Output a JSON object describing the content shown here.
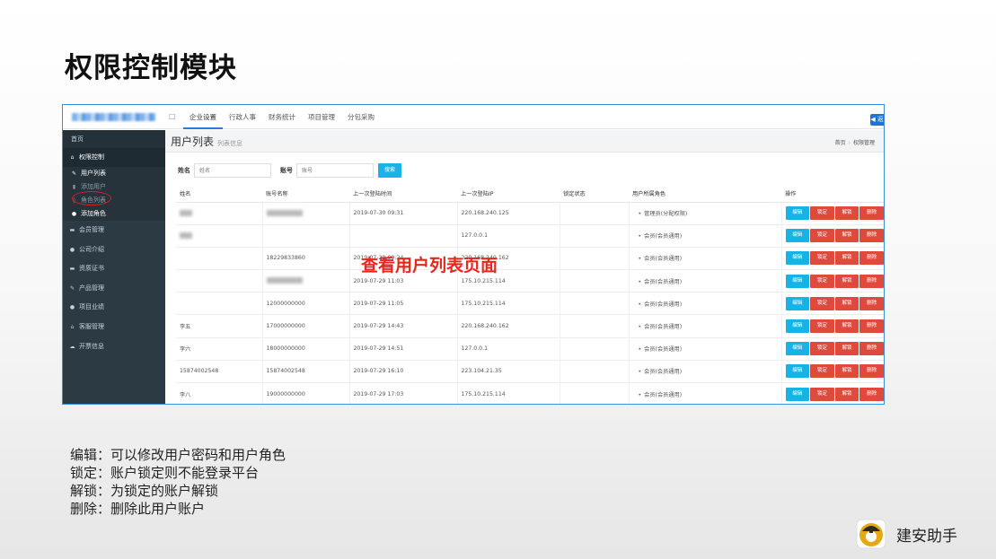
{
  "slide": {
    "title": "权限控制模块",
    "descriptions": [
      "编辑：可以修改用户密码和用户角色",
      "锁定：账户锁定则不能登录平台",
      "解锁：为锁定的账户解锁",
      "删除：删除此用户账户"
    ],
    "brand_name": "建安助手",
    "overlay_note": "查看用户列表页面"
  },
  "app": {
    "menu_toggle": "□",
    "top_nav": [
      "企业设置",
      "行政人事",
      "财务统计",
      "项目管理",
      "分包采购"
    ],
    "top_nav_active": 0,
    "corner_button": "◀ 返",
    "sidebar": {
      "home": "首页",
      "section": "权限控制",
      "sub_items": [
        "用户列表",
        "添加用户",
        "角色列表",
        "添加角色"
      ],
      "items": [
        "会员管理",
        "公司介绍",
        "资质证书",
        "产品管理",
        "项目业绩",
        "客服管理",
        "开票信息"
      ]
    },
    "page": {
      "title": "用户列表",
      "subtitle": "列表信息",
      "breadcrumb": [
        "首页",
        "权限管理"
      ]
    },
    "search": {
      "name_label": "姓名",
      "name_placeholder": "姓名",
      "account_label": "账号",
      "account_placeholder": "账号",
      "button": "搜索"
    },
    "table": {
      "columns": [
        "姓名",
        "账号名称",
        "上一次登陆时间",
        "上一次登陆IP",
        "锁定状态",
        "用户所属角色",
        "操作"
      ],
      "actions": [
        "编辑",
        "锁定",
        "解锁",
        "删除"
      ],
      "rows": [
        {
          "name": "",
          "account": "",
          "time": "2019-07-30 09:31",
          "ip": "220.168.240.125",
          "lock": "",
          "role": "管理员(分配权限)"
        },
        {
          "name": "",
          "account": "",
          "time": "",
          "ip": "127.0.0.1",
          "lock": "",
          "role": "会员(会员通用)"
        },
        {
          "name": "",
          "account": "18229833860",
          "time": "2019-07-29 09:24",
          "ip": "220.168.240.162",
          "lock": "",
          "role": "会员(会员通用)"
        },
        {
          "name": "",
          "account": "",
          "time": "2019-07-29 11:03",
          "ip": "175.10.215.114",
          "lock": "",
          "role": "会员(会员通用)"
        },
        {
          "name": "",
          "account": "12000000000",
          "time": "2019-07-29 11:05",
          "ip": "175.10.215.114",
          "lock": "",
          "role": "会员(会员通用)"
        },
        {
          "name": "李五",
          "account": "17000000000",
          "time": "2019-07-29 14:43",
          "ip": "220.168.240.162",
          "lock": "",
          "role": "会员(会员通用)"
        },
        {
          "name": "李六",
          "account": "18000000000",
          "time": "2019-07-29 14:51",
          "ip": "127.0.0.1",
          "lock": "",
          "role": "会员(会员通用)"
        },
        {
          "name": "15874002548",
          "account": "15874002548",
          "time": "2019-07-29 16:10",
          "ip": "223.104.21.35",
          "lock": "",
          "role": "会员(会员通用)"
        },
        {
          "name": "李八",
          "account": "19000000000",
          "time": "2019-07-29 17:03",
          "ip": "175.10.215.114",
          "lock": "",
          "role": "会员(会员通用)"
        }
      ],
      "blurred_cells": [
        [
          0,
          "name"
        ],
        [
          0,
          "account"
        ],
        [
          1,
          "name"
        ],
        [
          3,
          "account"
        ]
      ]
    }
  },
  "colors": {
    "accent_blue": "#1db1e6",
    "danger_red": "#df4a3d",
    "sidebar_bg": "#2b3a43",
    "note_red": "#e7261c"
  }
}
